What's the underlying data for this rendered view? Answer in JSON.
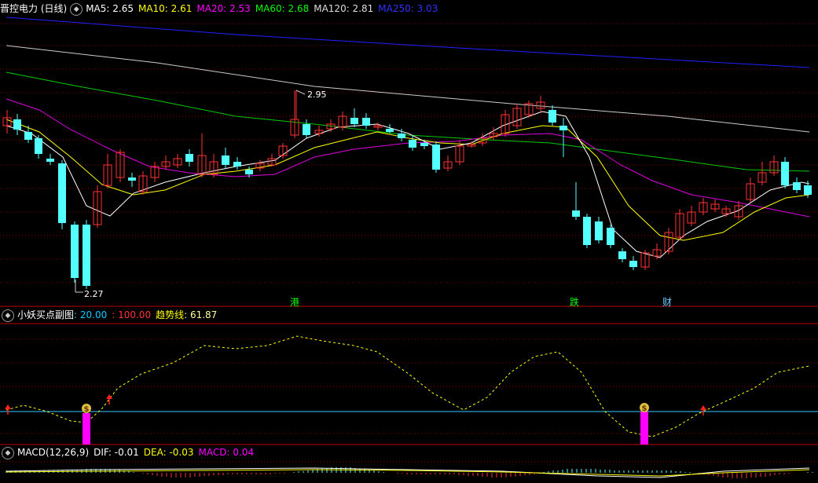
{
  "main": {
    "title": "晋控电力 (日线)",
    "ma": [
      {
        "label": "MA5: 2.65",
        "color": "#ffffff"
      },
      {
        "label": "MA10: 2.61",
        "color": "#ffff00"
      },
      {
        "label": "MA20: 2.53",
        "color": "#ff00ff"
      },
      {
        "label": "MA60: 2.68",
        "color": "#00ff00"
      },
      {
        "label": "MA120: 2.81",
        "color": "#dddddd"
      },
      {
        "label": "MA250: 3.03",
        "color": "#0000ff"
      }
    ],
    "high_label": "2.95",
    "low_label": "2.27",
    "tags": [
      {
        "text": "港",
        "color": "#00ff00"
      },
      {
        "text": "跌",
        "color": "#00ff00"
      },
      {
        "text": "财",
        "color": "#66ccff"
      }
    ]
  },
  "sub": {
    "title": "小妖买点副图",
    "v1": ": 20.00",
    "v2": ": 100.00",
    "trend_label": "趋势线",
    "trend_value": ": 61.87",
    "buy_glyph": "$"
  },
  "macd": {
    "title": "MACD(12,26,9)",
    "dif": "DIF: -0.01",
    "dea": "DEA: -0.03",
    "macd": "MACD: 0.04"
  },
  "colors": {
    "up": "#ff3333",
    "down": "#54ffff",
    "grid": "#8b0000",
    "panel_line": "#c00000"
  }
}
